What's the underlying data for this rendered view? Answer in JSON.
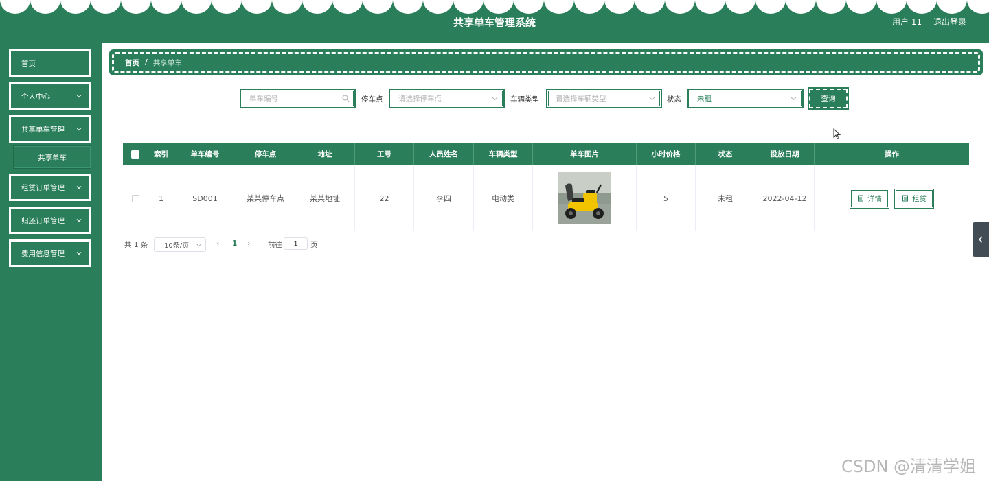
{
  "header": {
    "title": "共享单车管理系统",
    "user": "用户 11",
    "logout": "退出登录"
  },
  "sidebar": {
    "items": [
      {
        "label": "首页"
      },
      {
        "label": "个人中心"
      },
      {
        "label": "共享单车管理"
      },
      {
        "label": "租赁订单管理"
      },
      {
        "label": "归还订单管理"
      },
      {
        "label": "费用信息管理"
      }
    ],
    "submenu": [
      "共享单车"
    ]
  },
  "breadcrumb": {
    "home": "首页",
    "separator": "/",
    "current": "共享单车"
  },
  "search": {
    "bike_no_placeholder": "单车编号",
    "station_label": "停车点",
    "station_placeholder": "请选择停车点",
    "type_label": "车辆类型",
    "type_placeholder": "请选择车辆类型",
    "status_label": "状态",
    "status_value": "未租",
    "query_button": "查询"
  },
  "table": {
    "columns": [
      "索引",
      "单车编号",
      "停车点",
      "地址",
      "工号",
      "人员姓名",
      "车辆类型",
      "单车图片",
      "小时价格",
      "状态",
      "投放日期",
      "操作"
    ],
    "rows": [
      {
        "index": "1",
        "bike_no": "SD001",
        "station": "某某停车点",
        "address": "某某地址",
        "job_no": "22",
        "name": "李四",
        "vehicle_type": "电动类",
        "hour_price": "5",
        "status": "未租",
        "date": "2022-04-12",
        "detail_btn": "详情",
        "rent_btn": "租赁"
      }
    ]
  },
  "pagination": {
    "total": "共 1 条",
    "page_size": "10条/页",
    "current_page": "1",
    "goto_label": "前往",
    "goto_value": "1",
    "page_word": "页"
  },
  "watermark": "CSDN @清清学姐",
  "colors": {
    "primary": "#2a7f5a",
    "header_text": "#ffffff",
    "side_toggle": "#424c55"
  }
}
